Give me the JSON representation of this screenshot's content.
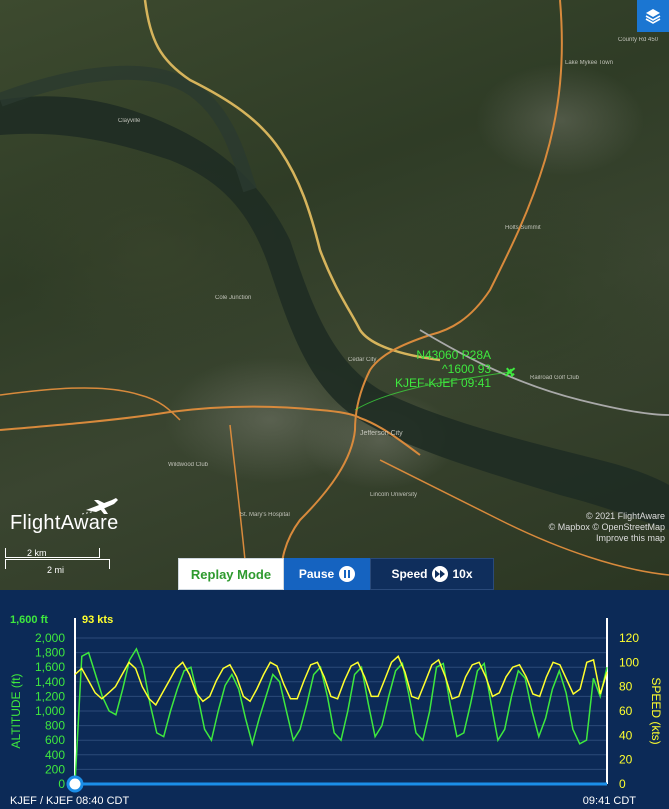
{
  "map": {
    "place_labels": [
      "Clayville",
      "Holts Summit",
      "Lake Mykee Town",
      "Jefferson City",
      "Cole Junction",
      "St. Mary's Hospital",
      "Lincoln University",
      "Wildwood Club",
      "Railroad Golf Club",
      "Cedar City",
      "County Rd 450"
    ],
    "flight_label": {
      "line1": "N43060 P28A",
      "line2": "^1600 93",
      "line3": "KJEF-KJEF 09:41"
    },
    "logo_text": "FlightAware",
    "scale_km": "2 km",
    "scale_mi": "2 mi",
    "attribution": [
      "© 2021 FlightAware",
      "© Mapbox © OpenStreetMap",
      "Improve this map"
    ],
    "layers_icon": "layers-icon",
    "colors": {
      "track": "#3ee83e",
      "road_major": "#d88a3c",
      "road_highway": "#d6b45c"
    }
  },
  "controls": {
    "replay_label": "Replay Mode",
    "pause_label": "Pause",
    "speed_label": "Speed",
    "speed_value": "10x"
  },
  "chart_data": {
    "type": "line",
    "current_altitude_label": "1,600 ft",
    "current_speed_label": "93 kts",
    "y_left": {
      "label": "ALTITUDE (ft)",
      "ticks": [
        "2,000",
        "1,800",
        "1,600",
        "1,400",
        "1,200",
        "1,000",
        "800",
        "600",
        "400",
        "200",
        "0"
      ],
      "range": [
        0,
        2000
      ],
      "color": "#3ee83e"
    },
    "y_right": {
      "label": "SPEED (kts)",
      "ticks": [
        "120",
        "100",
        "80",
        "60",
        "40",
        "20",
        "0"
      ],
      "range": [
        0,
        120
      ],
      "color": "#ffff2e"
    },
    "x_start_label": "KJEF / KJEF 08:40 CDT",
    "x_end_label": "09:41 CDT",
    "series": [
      {
        "name": "Altitude",
        "unit": "ft",
        "color": "#3ee83e",
        "values": [
          0,
          1750,
          1800,
          1500,
          1200,
          1000,
          950,
          1300,
          1700,
          1850,
          1600,
          1100,
          700,
          650,
          1000,
          1300,
          1550,
          1600,
          1200,
          750,
          600,
          1000,
          1350,
          1500,
          1300,
          900,
          550,
          900,
          1200,
          1500,
          1400,
          1000,
          600,
          750,
          1100,
          1500,
          1600,
          1200,
          700,
          600,
          1000,
          1500,
          1600,
          1100,
          650,
          800,
          1200,
          1550,
          1650,
          1200,
          700,
          600,
          1000,
          1600,
          1650,
          1100,
          650,
          700,
          1100,
          1550,
          1650,
          1100,
          600,
          750,
          1200,
          1550,
          1450,
          1000,
          650,
          900,
          1300,
          1550,
          1250,
          750,
          550,
          600,
          1450,
          1200,
          1600
        ]
      },
      {
        "name": "Speed",
        "unit": "kts",
        "color": "#ffff2e",
        "values": [
          90,
          95,
          85,
          75,
          70,
          75,
          80,
          90,
          100,
          95,
          80,
          70,
          65,
          75,
          85,
          95,
          100,
          90,
          75,
          68,
          72,
          85,
          95,
          98,
          88,
          72,
          68,
          78,
          90,
          100,
          97,
          82,
          70,
          70,
          85,
          98,
          100,
          88,
          72,
          70,
          85,
          97,
          100,
          88,
          72,
          72,
          86,
          100,
          105,
          92,
          72,
          70,
          84,
          98,
          102,
          88,
          70,
          72,
          88,
          98,
          100,
          88,
          72,
          75,
          88,
          96,
          98,
          88,
          74,
          72,
          88,
          100,
          98,
          86,
          74,
          78,
          100,
          102,
          74,
          92
        ]
      }
    ]
  }
}
